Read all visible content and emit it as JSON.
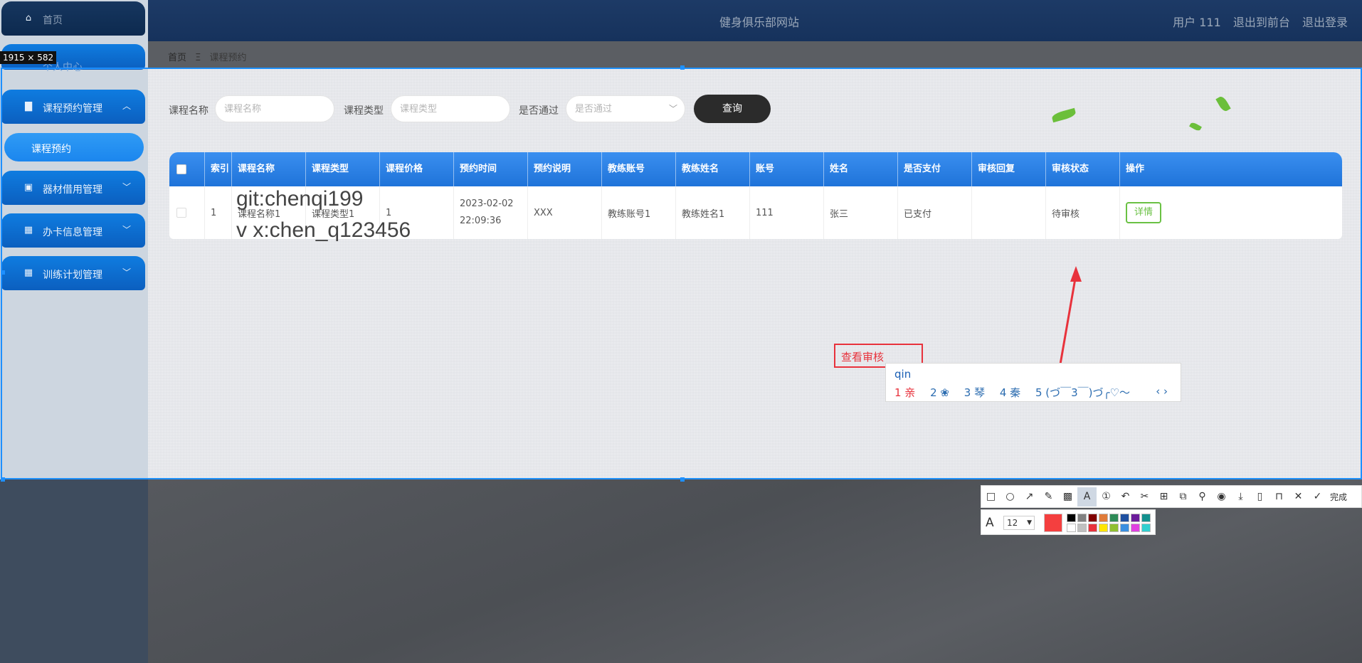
{
  "topbar": {
    "title": "健身俱乐部网站",
    "user": "用户 111",
    "back_front": "退出到前台",
    "logout": "退出登录"
  },
  "sidebar": {
    "items": [
      {
        "label": "首页",
        "icon": "home-icon"
      },
      {
        "label": "个人中心",
        "icon": "user-icon"
      },
      {
        "label": "课程预约管理",
        "icon": "briefcase-icon"
      },
      {
        "label": "器材借用管理",
        "icon": "clipboard-icon"
      },
      {
        "label": "办卡信息管理",
        "icon": "grid-icon"
      },
      {
        "label": "训练计划管理",
        "icon": "grid-icon"
      }
    ],
    "active_sub": "课程预约"
  },
  "breadcrumb": {
    "home": "首页",
    "sep": "Ξ",
    "current": "课程预约"
  },
  "search": {
    "course_name_label": "课程名称",
    "course_name_placeholder": "课程名称",
    "course_type_label": "课程类型",
    "course_type_placeholder": "课程类型",
    "passed_label": "是否通过",
    "passed_placeholder": "是否通过",
    "query_button": "查询"
  },
  "table": {
    "headers": [
      "索引",
      "课程名称",
      "课程类型",
      "课程价格",
      "预约时间",
      "预约说明",
      "教练账号",
      "教练姓名",
      "账号",
      "姓名",
      "是否支付",
      "审核回复",
      "审核状态",
      "操作"
    ],
    "rows": [
      {
        "index": "1",
        "course_name": "课程名称1",
        "course_type": "课程类型1",
        "price": "1",
        "time_date": "2023-02-02",
        "time_clock": "22:09:36",
        "note": "XXX",
        "coach_account": "教练账号1",
        "coach_name": "教练姓名1",
        "account": "111",
        "name": "张三",
        "paid": "已支付",
        "reply": "",
        "status": "待审核",
        "action": "详情"
      }
    ]
  },
  "watermark": {
    "line1": "git:chenqi199",
    "line2": "v x:chen_q123456"
  },
  "screenshot_tool": {
    "size_tip": "1915 × 582",
    "annotation_text": "查看审核",
    "ime_typed": "qin",
    "ime_candidates": [
      "1 亲",
      "2 ❀",
      "3 琴",
      "4 秦",
      "5 (づ￣3￣)づ╭♡～"
    ],
    "ime_nav": "‹  ›",
    "done_label": "完成",
    "font_size": "12",
    "current_color": "#f43f3f",
    "swatches": [
      "#000000",
      "#808080",
      "#800000",
      "#e07b39",
      "#2e8b57",
      "#1e50a0",
      "#6a1b9a",
      "#12908e",
      "#ffffff",
      "#c0c0c0",
      "#e8323c",
      "#ffe500",
      "#90c030",
      "#3a8fe0",
      "#e040e0",
      "#30d0d0"
    ],
    "tools": [
      "rect-icon",
      "circle-icon",
      "arrow-icon",
      "pen-icon",
      "mosaic-icon",
      "text-icon",
      "number-icon",
      "undo-icon",
      "crop-icon",
      "ocr-icon",
      "translate-icon",
      "pin-icon",
      "record-icon",
      "download-icon",
      "phone-icon",
      "bookmark-icon",
      "close-icon",
      "check-icon"
    ]
  }
}
